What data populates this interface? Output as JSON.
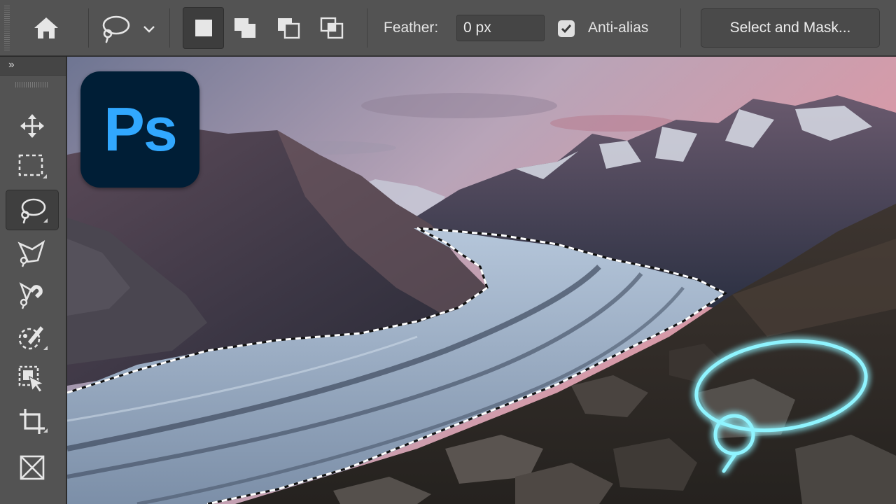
{
  "options_bar": {
    "tool_icon": "lasso-icon",
    "selection_modes": [
      "new-selection",
      "add-to-selection",
      "subtract-from-selection",
      "intersect-with-selection"
    ],
    "feather_label": "Feather:",
    "feather_value": "0 px",
    "anti_alias_label": "Anti-alias",
    "anti_alias_checked": true,
    "select_and_mask_label": "Select and Mask..."
  },
  "toolbar": {
    "collapse_glyph": "››",
    "tools": [
      "move-icon",
      "rectangular-marquee-icon",
      "lasso-icon",
      "polygonal-lasso-icon",
      "magnetic-lasso-icon",
      "quick-selection-icon",
      "object-selection-icon",
      "crop-icon",
      "frame-icon"
    ],
    "active_tool": "lasso-icon"
  },
  "logo": {
    "text": "Ps"
  },
  "colors": {
    "panel": "#535353",
    "logo_bg": "#001e36",
    "logo_text": "#31a8ff",
    "lasso_glow": "#7ef0ff"
  }
}
